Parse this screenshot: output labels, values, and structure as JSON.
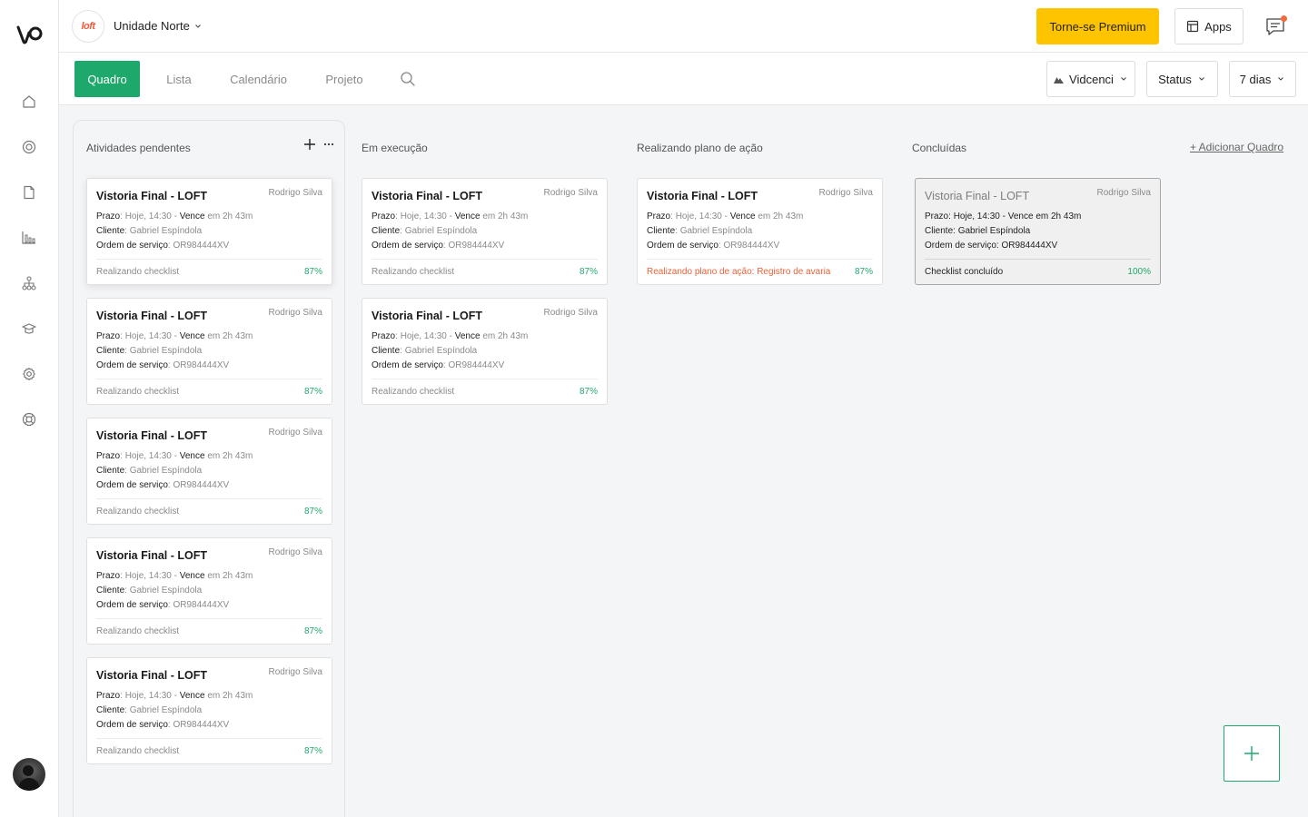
{
  "header": {
    "unit_logo_text": "loft",
    "unit_name": "Unidade Norte",
    "premium_label": "Torne-se Premium",
    "apps_label": "Apps"
  },
  "sidebar": {
    "items": [
      "home-icon",
      "target-icon",
      "document-icon",
      "bar-chart-icon",
      "org-chart-icon",
      "graduation-cap-icon",
      "gear-icon",
      "help-ring-icon"
    ]
  },
  "tabs": [
    {
      "label": "Quadro",
      "active": true
    },
    {
      "label": "Lista",
      "active": false
    },
    {
      "label": "Calendário",
      "active": false
    },
    {
      "label": "Projeto",
      "active": false
    }
  ],
  "filters": {
    "company": "Vidcenci",
    "status": "Status",
    "period": "7 dias"
  },
  "board": {
    "add_board_label": "+ Adicionar Quadro",
    "columns": [
      {
        "title": "Atividades pendentes"
      },
      {
        "title": "Em execução"
      },
      {
        "title": "Realizando plano de ação"
      },
      {
        "title": "Concluídas"
      }
    ]
  },
  "card_labels": {
    "title": "Vistoria Final - LOFT",
    "owner": "Rodrigo Silva",
    "prazo_label": "Prazo",
    "prazo_value": "Hoje, 14:30 -",
    "vence_label": "Vence",
    "vence_value": "em 2h 43m",
    "cliente_label": "Cliente",
    "cliente_value": "Gabriel Espíndola",
    "os_label": "Ordem de serviço",
    "os_value": "OR984444XV"
  },
  "statuses": {
    "checklist": "Realizando checklist",
    "action_plan": "Realizando plano de ação: Registro de avaria",
    "done": "Checklist concluído",
    "pct_default": "87%",
    "pct_done": "100%"
  },
  "colors": {
    "accent": "#1fa86b",
    "premium": "#ffc400",
    "alert": "#e8643a"
  }
}
